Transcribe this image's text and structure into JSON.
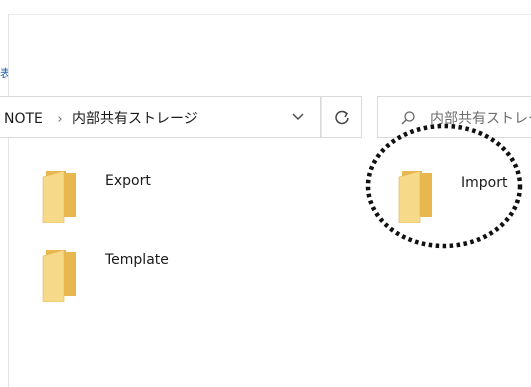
{
  "ribbon": {
    "fragment_text": "表示"
  },
  "address": {
    "segments": [
      "NOTE",
      "内部共有ストレージ"
    ],
    "separator": "›",
    "dropdown_icon": "chevron-down-icon",
    "refresh_icon": "refresh-icon"
  },
  "search": {
    "placeholder": "内部共有ストレージの検索",
    "icon": "search-icon"
  },
  "folders": [
    {
      "name": "Export",
      "icon": "folder-icon"
    },
    {
      "name": "Template",
      "icon": "folder-icon"
    },
    {
      "name": "Import",
      "icon": "folder-icon"
    }
  ],
  "colors": {
    "folder_body": "#f6d67c",
    "folder_back": "#e8b84f",
    "annotation": "#111111",
    "link_blue": "#2b63b5"
  }
}
